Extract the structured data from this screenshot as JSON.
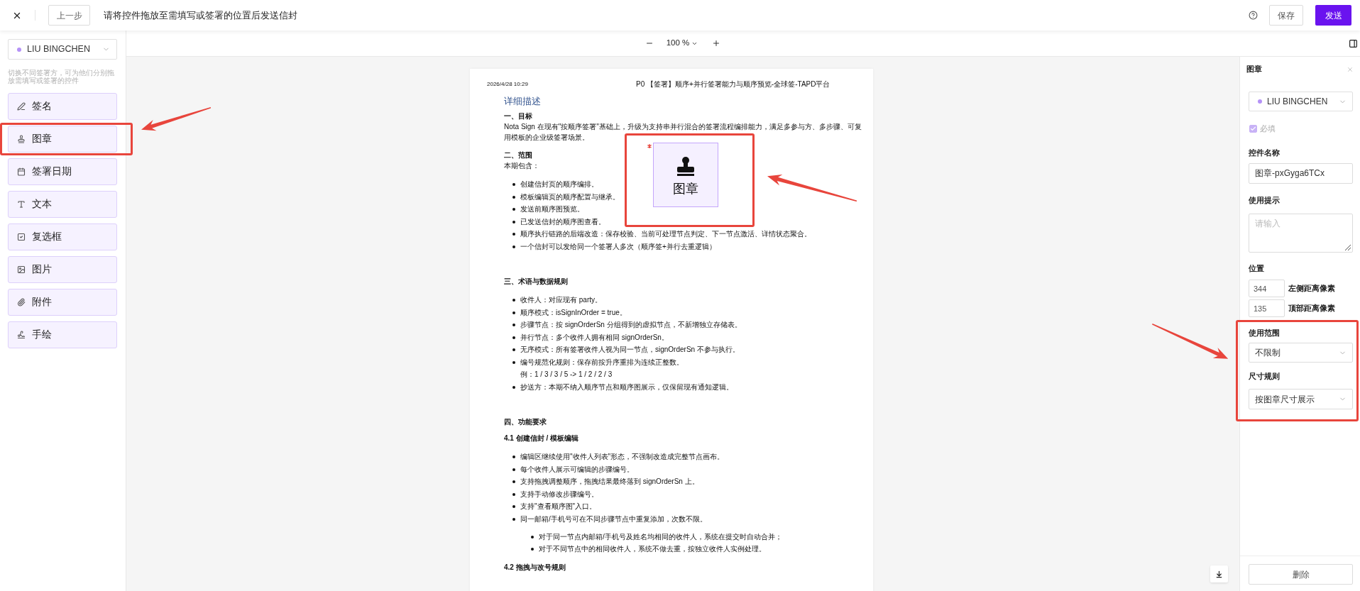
{
  "top_bar": {
    "back_button": "上一步",
    "title": "请将控件拖放至需填写或签署的位置后发送信封",
    "save_button": "保存",
    "send_button": "发送"
  },
  "sidebar": {
    "signer": "LIU BINGCHEN",
    "hint": "切换不同签署方，可为他们分别拖放需填写或签署的控件",
    "fields": [
      {
        "kind": "signature",
        "label": "签名"
      },
      {
        "kind": "stamp",
        "label": "图章"
      },
      {
        "kind": "date",
        "label": "签署日期"
      },
      {
        "kind": "text",
        "label": "文本"
      },
      {
        "kind": "checkbox",
        "label": "复选框"
      },
      {
        "kind": "image",
        "label": "图片"
      },
      {
        "kind": "attachment",
        "label": "附件"
      },
      {
        "kind": "handwriting",
        "label": "手绘"
      }
    ]
  },
  "toolbar": {
    "zoom": "100 %"
  },
  "document": {
    "date": "2026/4/28 10:29",
    "header_title": "P0 【签署】顺序+并行签署能力与顺序预览-全球签-TAPD平台",
    "blocks": [
      {
        "kind": "heading",
        "text": "详细描述"
      },
      {
        "kind": "section",
        "text": "一、目标"
      },
      {
        "kind": "paragraph",
        "text": "Nota Sign 在现有\"按顺序签署\"基础上，升级为支持串并行混合的签署流程编排能力，满足多参与方、多步骤、可复用模板的企业级签署场景。"
      },
      {
        "kind": "section",
        "text": "二、范围"
      },
      {
        "kind": "paragraph",
        "text": "本期包含："
      },
      {
        "kind": "list",
        "items": [
          {
            "text": "创建信封页的顺序编排。"
          },
          {
            "text": "模板编辑页的顺序配置与继承。"
          },
          {
            "text": "发送前顺序图预览。"
          },
          {
            "text": "已发送信封的顺序图查看。"
          },
          {
            "text": "顺序执行链路的后端改造：保存校验、当前可处理节点判定、下一节点激活、详情状态聚合。"
          },
          {
            "text": "一个信封可以发给同一个签署人多次（顺序签+并行去重逻辑）"
          }
        ]
      },
      {
        "kind": "section",
        "text": "三、术语与数据规则"
      },
      {
        "kind": "list",
        "items": [
          {
            "text": "收件人：对应现有 party。"
          },
          {
            "text": "顺序模式：isSignInOrder = true。"
          },
          {
            "text": "步骤节点：按 signOrderSn 分组得到的虚拟节点，不新增独立存储表。"
          },
          {
            "text": "并行节点：多个收件人拥有相同 signOrderSn。"
          },
          {
            "text": "无序模式：所有签署收件人视为同一节点，signOrderSn 不参与执行。"
          },
          {
            "text": "编号规范化规则：保存前按升序重排为连续正整数。",
            "note": "例：1 / 3 / 3 / 5 -> 1 / 2 / 2 / 3"
          },
          {
            "text": "抄送方：本期不纳入顺序节点和顺序图展示，仅保留现有通知逻辑。"
          }
        ]
      },
      {
        "kind": "section",
        "text": "四、功能要求"
      },
      {
        "kind": "subsection",
        "text": "4.1 创建信封 / 模板编辑"
      },
      {
        "kind": "list",
        "items": [
          {
            "text": "编辑区继续使用\"收件人列表\"形态，不强制改造成完整节点画布。"
          },
          {
            "text": "每个收件人展示可编辑的步骤编号。"
          },
          {
            "text": "支持拖拽调整顺序，拖拽结果最终落到 signOrderSn 上。"
          },
          {
            "text": "支持手动修改步骤编号。"
          },
          {
            "text": "支持\"查看顺序图\"入口。"
          },
          {
            "text": "同一邮箱/手机号可在不同步骤节点中重复添加，次数不限。",
            "children": [
              {
                "text": "对于同一节点内邮箱/手机号及姓名均相同的收件人，系统在提交时自动合并；"
              },
              {
                "text": "对于不同节点中的相同收件人，系统不做去重，按独立收件人实例处理。"
              }
            ]
          }
        ]
      },
      {
        "kind": "subsection",
        "text": "4.2 拖拽与改号规则"
      }
    ]
  },
  "placed_field": {
    "kind": "stamp",
    "label": "图章",
    "required": true
  },
  "properties_panel": {
    "title": "图章",
    "signer": "LIU BINGCHEN",
    "required": {
      "label": "必填",
      "checked": true,
      "disabled": true
    },
    "name_label": "控件名称",
    "name_value": "图章-pxGyga6TCx",
    "tip_label": "使用提示",
    "tip_placeholder": "请输入",
    "position_label": "位置",
    "position": [
      {
        "value": "344",
        "caption": "左侧距离像素"
      },
      {
        "value": "135",
        "caption": "顶部距离像素"
      }
    ],
    "scope_label": "使用范围",
    "scope_value": "不限制",
    "size_label": "尺寸规则",
    "size_value": "按图章尺寸展示",
    "delete_button": "删除"
  }
}
